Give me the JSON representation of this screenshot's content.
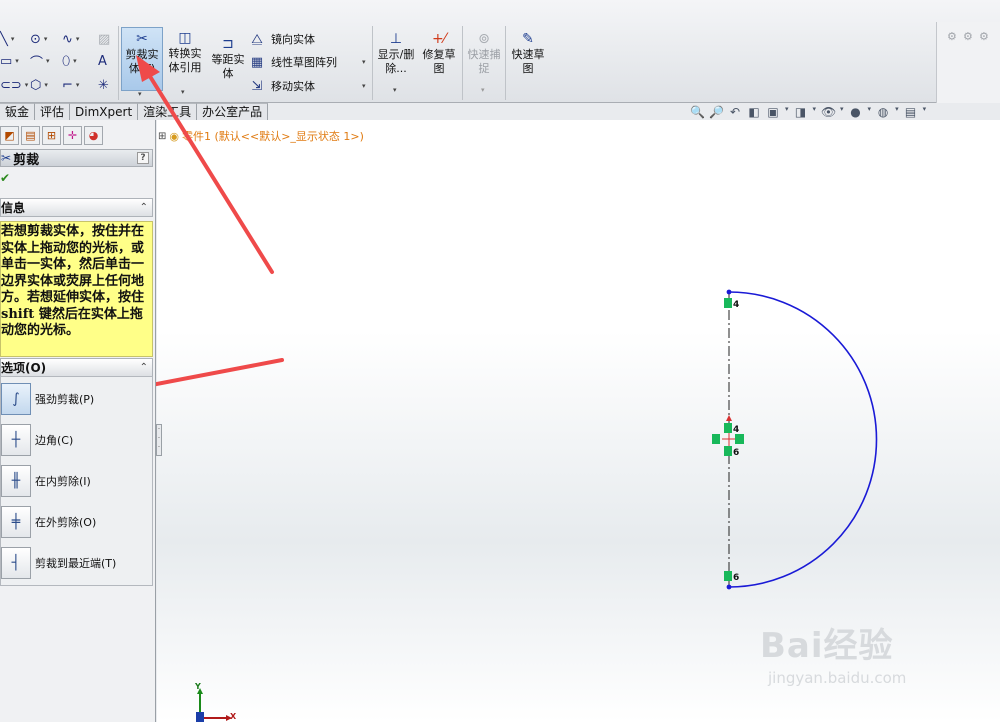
{
  "toolbar": {
    "trim_entities": "剪裁实体(T)",
    "convert_entities": "转换实体引用",
    "offset_entities": "等距实体",
    "mirror_entities": "镜向实体",
    "linear_pattern": "线性草图阵列",
    "move_entities": "移动实体",
    "display_delete": "显示/删除...",
    "repair_sketch": "修复草图",
    "quick_snaps": "快速捕捉",
    "rapid_sketch": "快速草图"
  },
  "tabs": [
    "钣金",
    "评估",
    "DimXpert",
    "渲染工具",
    "办公室产品"
  ],
  "property_manager": {
    "title": "剪裁",
    "help": "?",
    "message_header": "信息",
    "message_text": "若想剪裁实体，按住并在实体上拖动您的光标，或单击一实体，然后单击一边界实体或荧屏上任何地方。若想延伸实体，按住 shift 键然后在实体上拖动您的光标。",
    "options_header": "选项(O)",
    "options": [
      {
        "label": "强劲剪裁(P)",
        "selected": true
      },
      {
        "label": "边角(C)",
        "selected": false
      },
      {
        "label": "在内剪除(I)",
        "selected": false
      },
      {
        "label": "在外剪除(O)",
        "selected": false
      },
      {
        "label": "剪裁到最近端(T)",
        "selected": false
      }
    ]
  },
  "feature_tree": {
    "root": "零件1 (默认<<默认>_显示状态 1>)"
  },
  "sketch": {
    "relation_labels": [
      "4",
      "4",
      "6",
      "6"
    ],
    "arc_color": "#1a1ad6",
    "relation_color": "#18b85a"
  },
  "axes": {
    "y": "Y",
    "x": "X"
  },
  "watermark": {
    "line1": "Bai经验",
    "line2": "jingyan.baidu.com"
  },
  "colors": {
    "annotation_arrow": "#ef4a4a",
    "message_bg": "#ffff88"
  }
}
